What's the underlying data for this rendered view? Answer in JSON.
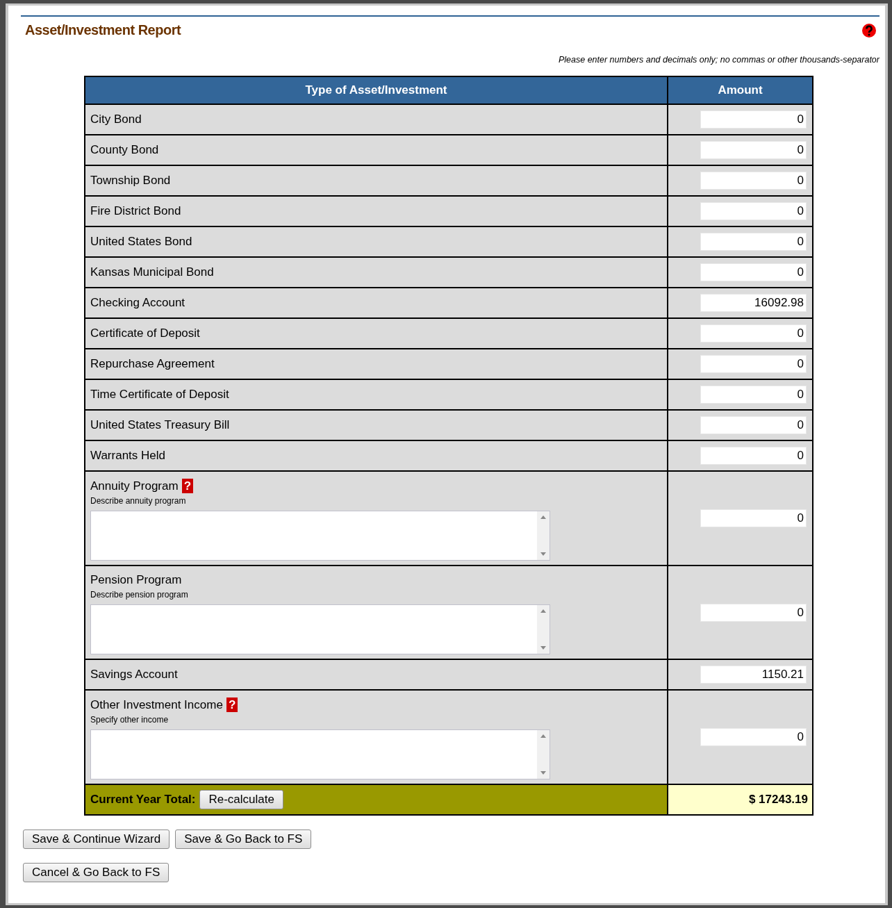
{
  "title": "Asset/Investment Report",
  "note": "Please enter numbers and decimals only; no commas or other thousands-separator",
  "table": {
    "columns": [
      "Type of Asset/Investment",
      "Amount"
    ],
    "rows": [
      {
        "kind": "simple",
        "label": "City Bond",
        "amount": "0"
      },
      {
        "kind": "simple",
        "label": "County Bond",
        "amount": "0"
      },
      {
        "kind": "simple",
        "label": "Township Bond",
        "amount": "0"
      },
      {
        "kind": "simple",
        "label": "Fire District Bond",
        "amount": "0"
      },
      {
        "kind": "simple",
        "label": "United States Bond",
        "amount": "0"
      },
      {
        "kind": "simple",
        "label": "Kansas Municipal Bond",
        "amount": "0"
      },
      {
        "kind": "simple",
        "label": "Checking Account",
        "amount": "16092.98"
      },
      {
        "kind": "simple",
        "label": "Certificate of Deposit",
        "amount": "0"
      },
      {
        "kind": "simple",
        "label": "Repurchase Agreement",
        "amount": "0"
      },
      {
        "kind": "simple",
        "label": "Time Certificate of Deposit",
        "amount": "0"
      },
      {
        "kind": "simple",
        "label": "United States Treasury Bill",
        "amount": "0"
      },
      {
        "kind": "simple",
        "label": "Warrants Held",
        "amount": "0"
      },
      {
        "kind": "described",
        "label": "Annuity Program",
        "help": "?",
        "description_label": "Describe annuity program",
        "amount": "0"
      },
      {
        "kind": "described",
        "label": "Pension Program",
        "description_label": "Describe pension program",
        "amount": "0"
      },
      {
        "kind": "simple",
        "label": "Savings Account",
        "amount": "1150.21"
      },
      {
        "kind": "described",
        "label": "Other Investment Income",
        "help": "?",
        "description_label": "Specify other income",
        "amount": "0"
      }
    ],
    "total": {
      "label": "Current Year Total:",
      "button": "Re-calculate",
      "value": "$ 17243.19"
    }
  },
  "buttons": [
    "Save & Continue Wizard",
    "Save & Go Back to FS",
    "Cancel & Go Back to FS"
  ]
}
